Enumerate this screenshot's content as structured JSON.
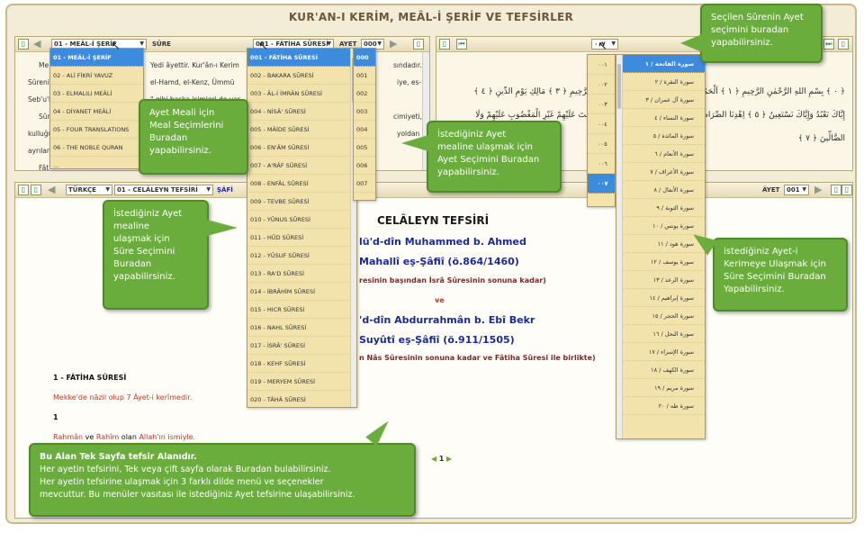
{
  "window": {
    "title": "KUR'AN-I KERİM, MEÂL-İ ŞERİF VE TEFSİRLER"
  },
  "left_panel": {
    "meal_select": "01 - MEÂL-İ ŞERİF",
    "sure_label": "SÛRE",
    "sure_select": "001 - FÂTİHA SÛRESİ",
    "ayet_label": "AYET",
    "ayet_select": "000",
    "text_lines": [
      "Me",
      "Sûrenin",
      "Seb'u'l-",
      "Sûr",
      "kulluğu",
      "ayrılanla",
      "Fât"
    ],
    "text_fragments": [
      "Yedi âyettir. Kur'ân-ı Kerim",
      "el-Hamd, el-Kenz, Ümmü",
      "\" gibi başka isimleri de var",
      "sındadır.",
      "iye, es-",
      "cimiyeti,",
      "yoldan"
    ]
  },
  "meal_dropdown": {
    "items": [
      "01 - MEÂL-İ ŞERİF",
      "02 - ALİ FİKRİ YAVUZ",
      "03 - ELMALILI MEÂLİ",
      "04 - DİYANET MEÂLİ",
      "05 - FOUR TRANSLATIONS",
      "06 - THE NOBLE QURAN",
      "..."
    ],
    "selected_index": 0
  },
  "sure_dropdown": {
    "items": [
      "001 - FÂTİHA SÛRESİ",
      "002 - BAKARA SÛRESİ",
      "003 - ÂL-İ İMRÂN SÛRESİ",
      "004 - NİSÂ' SÛRESİ",
      "005 - MÂİDE SÛRESİ",
      "006 - EN'ÂM SÛRESİ",
      "007 - A'RÂF SÛRESİ",
      "008 - ENFÂL SÛRESİ",
      "009 - TEVBE SÛRESİ",
      "010 - YÛNUS SÛRESİ",
      "011 - HÛD SÛRESİ",
      "012 - YÛSUF SÛRESİ",
      "013 - RA'D SÛRESİ",
      "014 - İBRÂHİM SÛRESİ",
      "015 - HICR SÛRESİ",
      "016 - NAHL SÛRESİ",
      "017 - İSRÂ' SÛRESİ",
      "018 - KEHF SÛRESİ",
      "019 - MERYEM SÛRESİ",
      "020 - TÂHÂ SÛRESİ"
    ],
    "selected_index": 0
  },
  "ayet_dropdown": {
    "items": [
      "000",
      "001",
      "002",
      "003",
      "004",
      "005",
      "006",
      "007"
    ],
    "selected_index": 0
  },
  "right_panel": {
    "ayet_select": "٠٠٧",
    "arabic_lines": [
      "﴿ ٠ ﴾ بِسْمِ اللهِ الرَّحْمٰنِ الرَّحِيمِ ﴿ ١ ﴾ اَلْحَمْدُ لِلّٰهِ رَبِّ الْعَالَمِينَ ﴿ ٢ ﴾ اَلرَّحْمٰنِ الرَّحِيمِ ﴿ ٣ ﴾ مَالِكِ يَوْمِ الدِّينِ ﴿ ٤ ﴾",
      "إِيَّاكَ نَعْبُدُ وَإِيَّاكَ نَسْتَعِينُ ﴿ ٥ ﴾ اِهْدِنَا الصِّرَاطَ الْمُسْتَقِيمَ ﴿ ٦ ﴾ صِرَاطَ الَّذِينَ أَنْعَمْتَ عَلَيْهِمْ غَيْرِ الْمَغْضُوبِ عَلَيْهِمْ وَلَا",
      "الضَّالِّينَ ﴿ ٧ ﴾"
    ]
  },
  "arabic_ayet_dropdown": {
    "items": [
      "٠٠١",
      "٠٠٢",
      "٠٠٣",
      "٠٠٤",
      "٠٠٥",
      "٠٠٦",
      "٠٠٧"
    ],
    "selected_index": 6
  },
  "arabic_sure_dropdown": {
    "items": [
      "سورة الفاتحة / ١",
      "سورة البقرة / ٢",
      "سورة آل عمران / ٣",
      "سورة النساء / ٤",
      "سورة المائدة / ٥",
      "سورة الأنعام / ٦",
      "سورة الأعراف / ٧",
      "سورة الأنفال / ٨",
      "سورة التوبة / ٩",
      "سورة يونس / ١٠",
      "سورة هود / ١١",
      "سورة يوسف / ١٢",
      "سورة الرعد / ١٣",
      "سورة إبراهيم / ١٤",
      "سورة الحجر / ١٥",
      "سورة النحل / ١٦",
      "سورة الإسراء / ١٧",
      "سورة الكهف / ١٨",
      "سورة مريم / ١٩",
      "سورة طه / ٢٠"
    ],
    "selected_index": 0
  },
  "tafsir_panel": {
    "language_select": "TÜRKÇE",
    "tafsir_select": "01 - CELÂLEYN TEFSİRİ",
    "sure_fragment": "ŞÂFİ",
    "ayet_label": "ÂYET",
    "ayet_select": "001",
    "heading": "CELÂLEYN TEFSİRİ",
    "lines": [
      "lü'd-dîn Muhammed b. Ahmed",
      "Mahallî eş-Şâfiî (ö.864/1460)",
      "resinin başından İsrâ Sûresinin sonuna kadar)",
      "ve",
      "'d-dîn Abdurrahmân b. Ebî Bekr",
      "Suyûtî eş-Şâfiî (ö.911/1505)",
      "n Nâs Sûresinin sonuna kadar ve Fâtiha Sûresi ile birlikte)"
    ],
    "sure_title": "1 - FÂTİHA SÛRESİ",
    "sure_note": "Mekke'de nâzil olup 7 Âyet-i kerîmedir.",
    "ayet_number": "1",
    "rahman_word": "Rahmân",
    "and_word": " ve ",
    "rahim_word": "Rahîm",
    "rest_text": " olan ",
    "allah_text": "Allah'ın ismiyle.",
    "page_number": "1"
  },
  "callouts": {
    "top_right": [
      "Seçilen Sûrenin Ayet",
      "seçimini buradan",
      "yapabilirsiniz."
    ],
    "meal": [
      "Ayet Meali için",
      "Meal Seçimlerini",
      "Buradan",
      "yapabilirsiniz."
    ],
    "ayet_meal": [
      "İstediğiniz Ayet",
      "mealine ulaşmak için",
      "Ayet Seçimini Buradan",
      "yapabilirsiniz."
    ],
    "sure_meal": [
      "İstediğiniz Ayet",
      "mealine",
      "ulaşmak için",
      "Süre Seçimini",
      "Buradan",
      "yapabilirsiniz."
    ],
    "ayet_kerime": [
      "istediğiniz Ayet-i",
      "Kerimeye Ulaşmak için",
      "Süre Seçimini Buradan",
      "Yapabilirsiniz."
    ],
    "bottom_title": "Bu Alan Tek Sayfa tefsir Alanıdır.",
    "bottom_lines": [
      "Her ayetin tefsirini, Tek veya çift sayfa olarak Buradan bulabilirsiniz.",
      "Her ayetin tefsirine ulaşmak için 3 farklı dilde menü ve seçenekler",
      "mevcuttur. Bu menüler vasıtası ile istediğiniz Ayet tefsirine ulaşabilirsiniz."
    ]
  },
  "colors": {
    "accent_green": "#6aad3d",
    "highlight_blue": "#3d8bdc",
    "tafsir_blue": "#1a2a9c",
    "tafsir_red": "#c0392b"
  }
}
